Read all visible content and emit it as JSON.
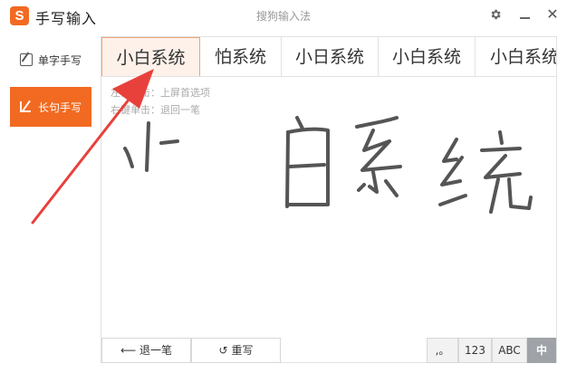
{
  "titlebar": {
    "logo_letter": "S",
    "app_title": "手写输入",
    "window_title": "搜狗输入法",
    "settings_icon": "gear-icon",
    "minimize_icon": "minimize-icon",
    "close_icon": "close-icon",
    "close_glyph": "✕"
  },
  "sidebar": {
    "items": [
      {
        "label": "单字手写",
        "icon": "edit-icon",
        "active": false
      },
      {
        "label": "长句手写",
        "icon": "pen-icon",
        "active": true
      }
    ]
  },
  "candidates": [
    "小白系统",
    "怕系统",
    "小日系统",
    "小白系统",
    "小白系统"
  ],
  "hints": {
    "line1": "左键单击：上屏首选项",
    "line2": "右键单击：退回一笔"
  },
  "bottom": {
    "undo_label": "退一笔",
    "undo_icon": "arrow-left-icon",
    "rewrite_label": "重写",
    "rewrite_icon": "refresh-icon",
    "modes": [
      ",。",
      "123",
      "ABC",
      "中"
    ],
    "active_mode": "中"
  },
  "colors": {
    "accent": "#f26a21",
    "active_mode_bg": "#9fa3a8",
    "ink": "#555555",
    "annotation_arrow": "#e8413c"
  }
}
